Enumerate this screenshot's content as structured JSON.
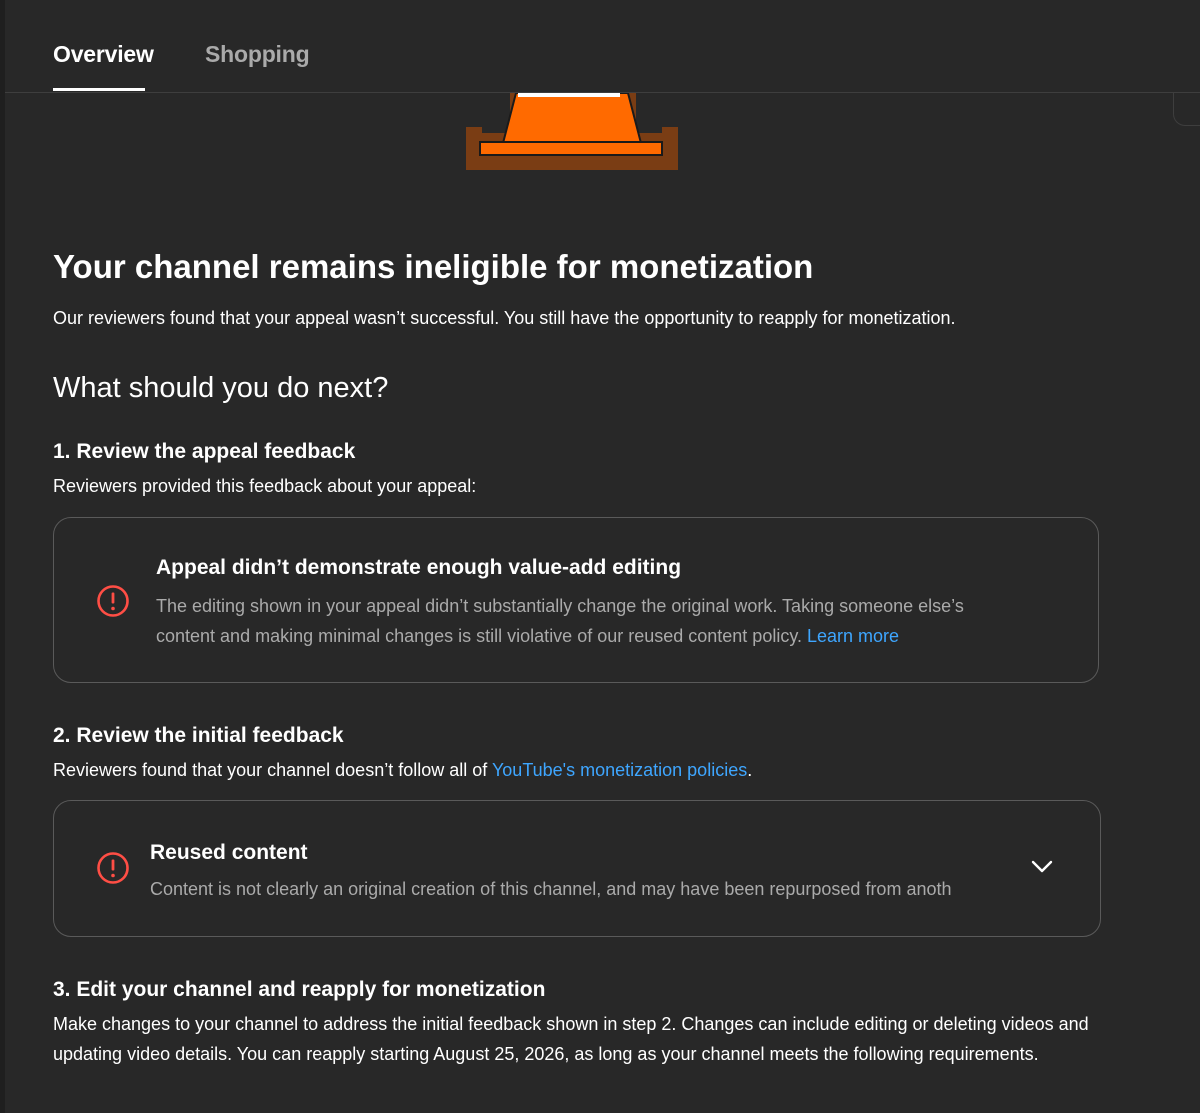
{
  "tabs": {
    "overview": "Overview",
    "shopping": "Shopping"
  },
  "main": {
    "title": "Your channel remains ineligible for monetization",
    "intro": "Our reviewers found that your appeal wasn’t successful. You still have the opportunity to reapply for monetization.",
    "next_heading": "What should you do next?"
  },
  "step1": {
    "heading": "1. Review the appeal feedback",
    "description": "Reviewers provided this feedback about your appeal:",
    "card": {
      "title": "Appeal didn’t demonstrate enough value-add editing",
      "body_line1": "The editing shown in your appeal didn’t substantially change the original work. Taking someone else’s",
      "body_line2": "content and making minimal changes is still violative of our reused content policy.",
      "link": "Learn more"
    }
  },
  "step2": {
    "heading": "2. Review the initial feedback",
    "description_prefix": "Reviewers found that your channel doesn’t follow all of ",
    "description_link": "YouTube's monetization policies",
    "description_suffix": ".",
    "card": {
      "title": "Reused content",
      "body": "Content is not clearly an original creation of this channel, and may have been repurposed from anoth"
    }
  },
  "step3": {
    "heading": "3. Edit your channel and reapply for monetization",
    "description": "Make changes to your channel to address the initial feedback shown in step 2. Changes can include editing or deleting videos and updating video details. You can reapply starting August 25, 2026, as long as your channel meets the following requirements."
  },
  "icons": {
    "alert": "alert-circle-icon",
    "expand": "chevron-down-icon"
  },
  "colors": {
    "background": "#282828",
    "link": "#3ea6ff",
    "alert": "#ff4e45",
    "cone_orange": "#ff6a00",
    "cone_shadow": "#7a3d14"
  }
}
